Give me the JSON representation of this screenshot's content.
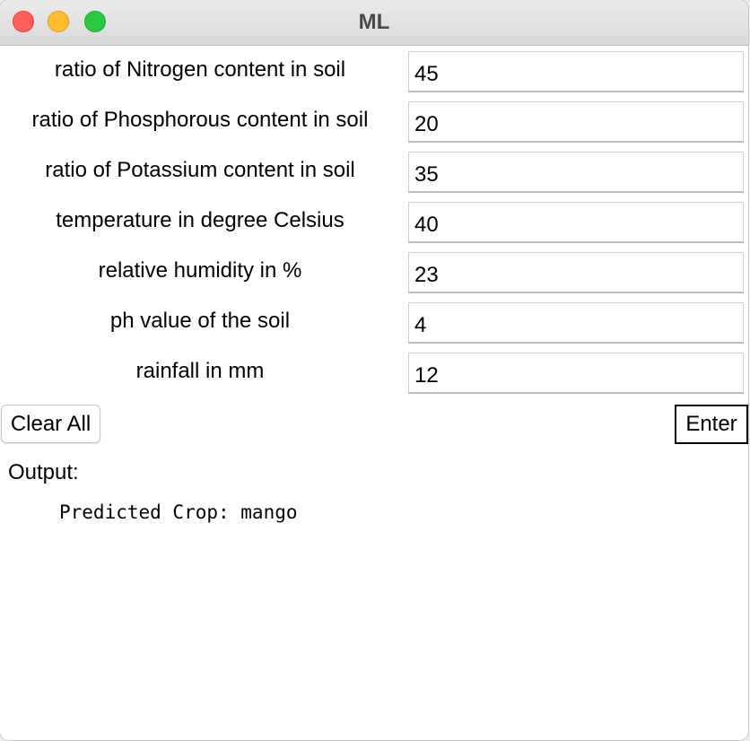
{
  "window": {
    "title": "ML"
  },
  "form": {
    "fields": [
      {
        "label": "ratio of Nitrogen content in soil",
        "value": "45"
      },
      {
        "label": "ratio of Phosphorous content in soil",
        "value": "20"
      },
      {
        "label": "ratio of Potassium content in soil",
        "value": "35"
      },
      {
        "label": "temperature in degree Celsius",
        "value": "40"
      },
      {
        "label": "relative humidity in %",
        "value": "23"
      },
      {
        "label": "ph value of the soil",
        "value": "4"
      },
      {
        "label": "rainfall in mm",
        "value": "12"
      }
    ]
  },
  "buttons": {
    "clear_label": "Clear All",
    "enter_label": "Enter"
  },
  "output": {
    "label": "Output:",
    "text": "Predicted Crop: mango"
  },
  "colors": {
    "close": "#ff5f57",
    "minimize": "#febc2e",
    "zoom": "#28c840"
  }
}
